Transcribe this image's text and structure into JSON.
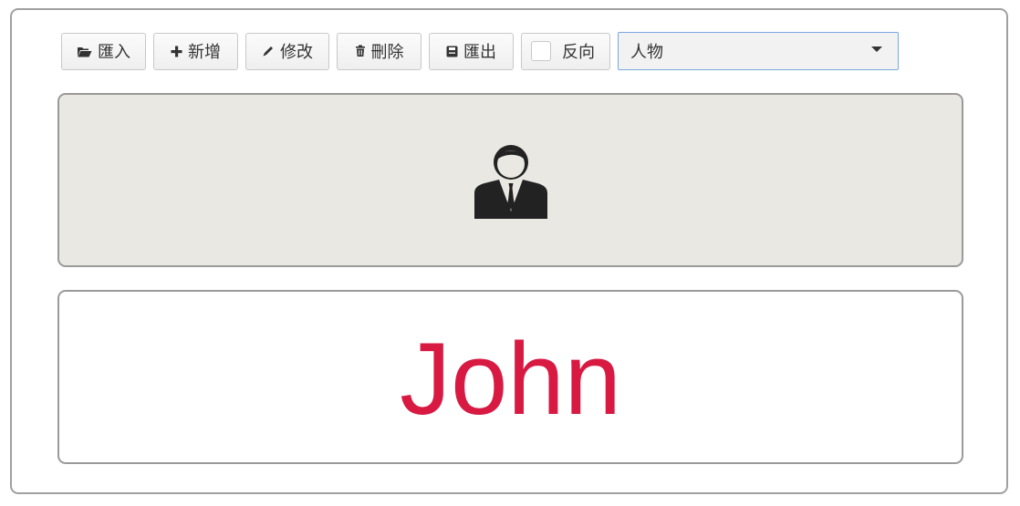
{
  "toolbar": {
    "import_label": "匯入",
    "import_icon": "folder-open-icon",
    "add_label": "新增",
    "add_icon": "plus-icon",
    "edit_label": "修改",
    "edit_icon": "pencil-icon",
    "delete_label": "刪除",
    "delete_icon": "trash-icon",
    "export_label": "匯出",
    "export_icon": "save-icon",
    "reverse_label": "反向",
    "reverse_checked": false
  },
  "category_select": {
    "selected": "人物"
  },
  "card": {
    "image_icon": "businessman-icon",
    "name": "John",
    "name_color": "#d81a43",
    "image_bg": "#e9e8e2"
  }
}
